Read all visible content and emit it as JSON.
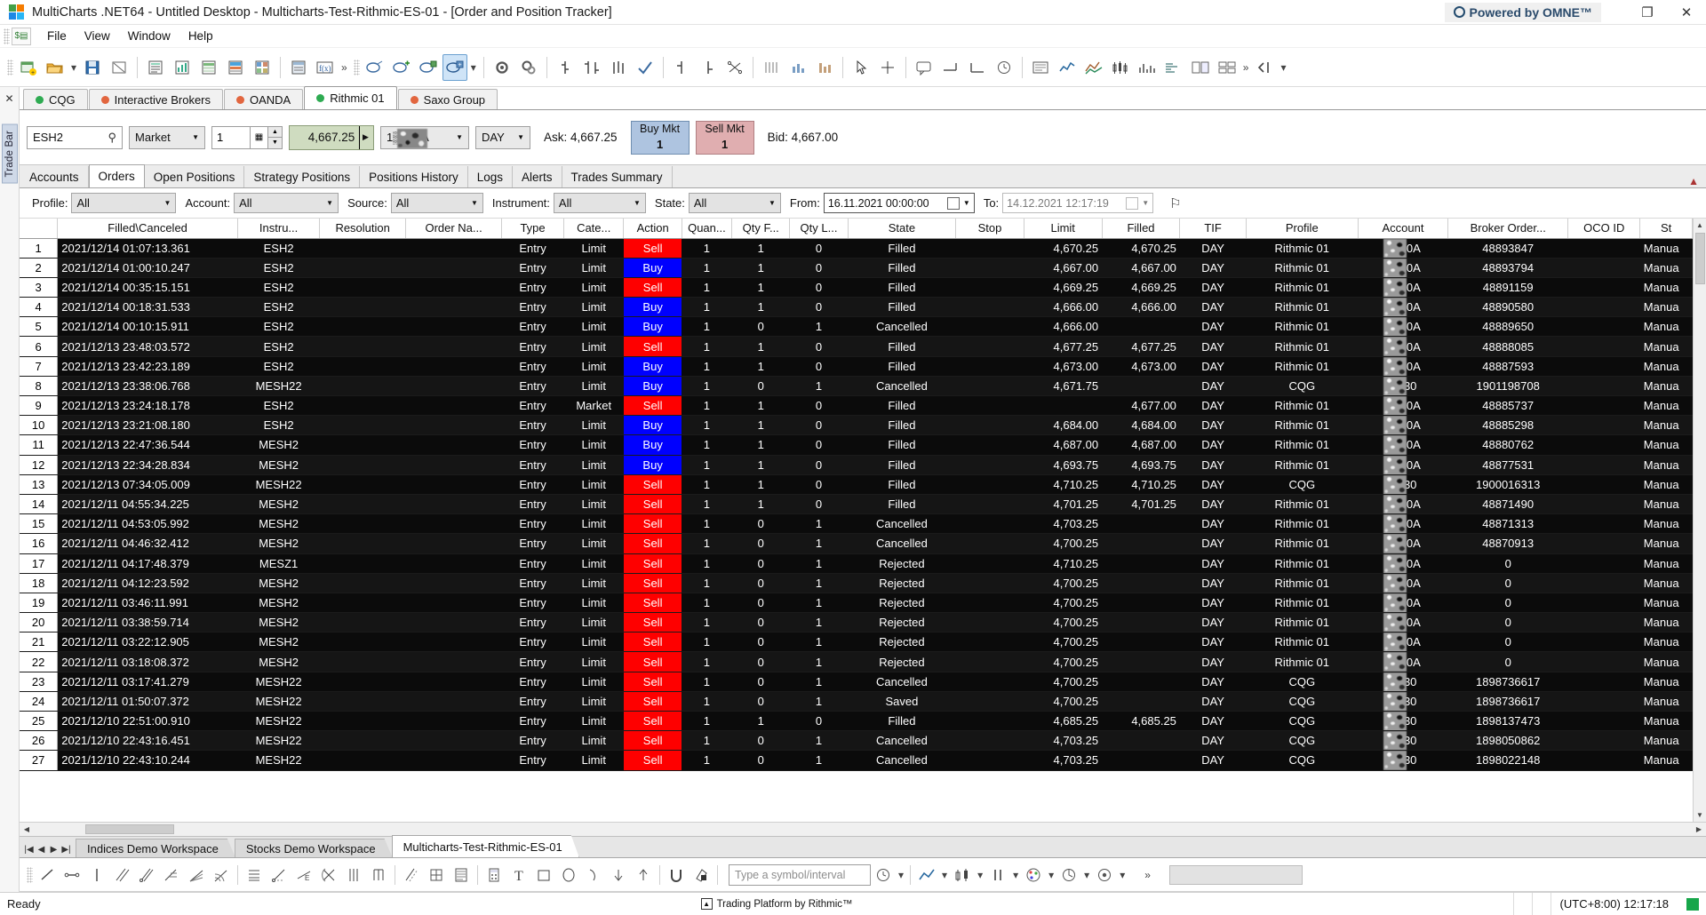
{
  "window": {
    "title": "MultiCharts .NET64 - Untitled Desktop - Multicharts-Test-Rithmic-ES-01 - [Order and Position Tracker]",
    "branding": "Powered by OMNE™",
    "restore_label": "❐",
    "close_label": "✕"
  },
  "menu": {
    "items": [
      "File",
      "View",
      "Window",
      "Help"
    ]
  },
  "rail": {
    "label": "Trade Bar",
    "close": "✕"
  },
  "connections": [
    {
      "name": "CQG",
      "status_color": "#2eab52"
    },
    {
      "name": "Interactive Brokers",
      "status_color": "#e2663f"
    },
    {
      "name": "OANDA",
      "status_color": "#e2663f"
    },
    {
      "name": "Rithmic 01",
      "status_color": "#2eab52",
      "selected": true
    },
    {
      "name": "Saxo Group",
      "status_color": "#e2663f"
    }
  ],
  "tradebar": {
    "symbol": "ESH2",
    "search_icon": "⚲",
    "order_type": "Market",
    "quantity": "1",
    "price": "4,667.25",
    "account": "1▒▒30A",
    "tif": "DAY",
    "ask_label": "Ask: 4,667.25",
    "bid_label": "Bid: 4,667.00",
    "buy_button": {
      "label": "Buy Mkt",
      "qty": "1"
    },
    "sell_button": {
      "label": "Sell Mkt",
      "qty": "1"
    }
  },
  "panel_tabs": [
    "Accounts",
    "Orders",
    "Open Positions",
    "Strategy Positions",
    "Positions History",
    "Logs",
    "Alerts",
    "Trades Summary"
  ],
  "panel_tab_selected": "Orders",
  "filters": {
    "profile": {
      "label": "Profile:",
      "value": "All"
    },
    "account": {
      "label": "Account:",
      "value": "All"
    },
    "source": {
      "label": "Source:",
      "value": "All"
    },
    "instrument": {
      "label": "Instrument:",
      "value": "All"
    },
    "state": {
      "label": "State:",
      "value": "All"
    },
    "from": {
      "label": "From:",
      "value": "16.11.2021 00:00:00"
    },
    "to": {
      "label": "To:",
      "value": "14.12.2021 12:17:19"
    },
    "pin_icon": "⚐"
  },
  "grid": {
    "columns": [
      "Filled\\Canceled",
      "Instru...",
      "Resolution",
      "Order Na...",
      "Type",
      "Cate...",
      "Action",
      "Quan...",
      "Qty F...",
      "Qty L...",
      "State",
      "Stop",
      "Limit",
      "Filled",
      "TIF",
      "Profile",
      "Account",
      "Broker Order...",
      "OCO ID",
      "St"
    ],
    "rows": [
      {
        "n": "1",
        "filled_canceled": "2021/12/14 01:07:13.361",
        "instrument": "ESH2",
        "resolution": "",
        "order_name": "",
        "type": "Entry",
        "category": "Limit",
        "action": "Sell",
        "qty": "1",
        "qty_filled": "1",
        "qty_left": "0",
        "state": "Filled",
        "stop": "",
        "limit": "4,670.25",
        "filled": "4,670.25",
        "tif": "DAY",
        "profile": "Rithmic 01",
        "account": "1▒30A",
        "broker_order_id": "48893847",
        "oco_id": "",
        "status": "Manua"
      },
      {
        "n": "2",
        "filled_canceled": "2021/12/14 01:00:10.247",
        "instrument": "ESH2",
        "resolution": "",
        "order_name": "",
        "type": "Entry",
        "category": "Limit",
        "action": "Buy",
        "qty": "1",
        "qty_filled": "1",
        "qty_left": "0",
        "state": "Filled",
        "stop": "",
        "limit": "4,667.00",
        "filled": "4,667.00",
        "tif": "DAY",
        "profile": "Rithmic 01",
        "account": "1▒30A",
        "broker_order_id": "48893794",
        "oco_id": "",
        "status": "Manua"
      },
      {
        "n": "3",
        "filled_canceled": "2021/12/14 00:35:15.151",
        "instrument": "ESH2",
        "resolution": "",
        "order_name": "",
        "type": "Entry",
        "category": "Limit",
        "action": "Sell",
        "qty": "1",
        "qty_filled": "1",
        "qty_left": "0",
        "state": "Filled",
        "stop": "",
        "limit": "4,669.25",
        "filled": "4,669.25",
        "tif": "DAY",
        "profile": "Rithmic 01",
        "account": "1▒30A",
        "broker_order_id": "48891159",
        "oco_id": "",
        "status": "Manua"
      },
      {
        "n": "4",
        "filled_canceled": "2021/12/14 00:18:31.533",
        "instrument": "ESH2",
        "resolution": "",
        "order_name": "",
        "type": "Entry",
        "category": "Limit",
        "action": "Buy",
        "qty": "1",
        "qty_filled": "1",
        "qty_left": "0",
        "state": "Filled",
        "stop": "",
        "limit": "4,666.00",
        "filled": "4,666.00",
        "tif": "DAY",
        "profile": "Rithmic 01",
        "account": "1▒30A",
        "broker_order_id": "48890580",
        "oco_id": "",
        "status": "Manua"
      },
      {
        "n": "5",
        "filled_canceled": "2021/12/14 00:10:15.911",
        "instrument": "ESH2",
        "resolution": "",
        "order_name": "",
        "type": "Entry",
        "category": "Limit",
        "action": "Buy",
        "qty": "1",
        "qty_filled": "0",
        "qty_left": "1",
        "state": "Cancelled",
        "stop": "",
        "limit": "4,666.00",
        "filled": "",
        "tif": "DAY",
        "profile": "Rithmic 01",
        "account": "1▒30A",
        "broker_order_id": "48889650",
        "oco_id": "",
        "status": "Manua"
      },
      {
        "n": "6",
        "filled_canceled": "2021/12/13 23:48:03.572",
        "instrument": "ESH2",
        "resolution": "",
        "order_name": "",
        "type": "Entry",
        "category": "Limit",
        "action": "Sell",
        "qty": "1",
        "qty_filled": "1",
        "qty_left": "0",
        "state": "Filled",
        "stop": "",
        "limit": "4,677.25",
        "filled": "4,677.25",
        "tif": "DAY",
        "profile": "Rithmic 01",
        "account": "1▒30A",
        "broker_order_id": "48888085",
        "oco_id": "",
        "status": "Manua"
      },
      {
        "n": "7",
        "filled_canceled": "2021/12/13 23:42:23.189",
        "instrument": "ESH2",
        "resolution": "",
        "order_name": "",
        "type": "Entry",
        "category": "Limit",
        "action": "Buy",
        "qty": "1",
        "qty_filled": "1",
        "qty_left": "0",
        "state": "Filled",
        "stop": "",
        "limit": "4,673.00",
        "filled": "4,673.00",
        "tif": "DAY",
        "profile": "Rithmic 01",
        "account": "1▒30A",
        "broker_order_id": "48887593",
        "oco_id": "",
        "status": "Manua"
      },
      {
        "n": "8",
        "filled_canceled": "2021/12/13 23:38:06.768",
        "instrument": "MESH22",
        "resolution": "",
        "order_name": "",
        "type": "Entry",
        "category": "Limit",
        "action": "Buy",
        "qty": "1",
        "qty_filled": "0",
        "qty_left": "1",
        "state": "Cancelled",
        "stop": "",
        "limit": "4,671.75",
        "filled": "",
        "tif": "DAY",
        "profile": "CQG",
        "account": "1▒30",
        "broker_order_id": "1901198708",
        "oco_id": "",
        "status": "Manua"
      },
      {
        "n": "9",
        "filled_canceled": "2021/12/13 23:24:18.178",
        "instrument": "ESH2",
        "resolution": "",
        "order_name": "",
        "type": "Entry",
        "category": "Market",
        "action": "Sell",
        "qty": "1",
        "qty_filled": "1",
        "qty_left": "0",
        "state": "Filled",
        "stop": "",
        "limit": "",
        "filled": "4,677.00",
        "tif": "DAY",
        "profile": "Rithmic 01",
        "account": "1▒30A",
        "broker_order_id": "48885737",
        "oco_id": "",
        "status": "Manua"
      },
      {
        "n": "10",
        "filled_canceled": "2021/12/13 23:21:08.180",
        "instrument": "ESH2",
        "resolution": "",
        "order_name": "",
        "type": "Entry",
        "category": "Limit",
        "action": "Buy",
        "qty": "1",
        "qty_filled": "1",
        "qty_left": "0",
        "state": "Filled",
        "stop": "",
        "limit": "4,684.00",
        "filled": "4,684.00",
        "tif": "DAY",
        "profile": "Rithmic 01",
        "account": "1▒30A",
        "broker_order_id": "48885298",
        "oco_id": "",
        "status": "Manua"
      },
      {
        "n": "11",
        "filled_canceled": "2021/12/13 22:47:36.544",
        "instrument": "MESH2",
        "resolution": "",
        "order_name": "",
        "type": "Entry",
        "category": "Limit",
        "action": "Buy",
        "qty": "1",
        "qty_filled": "1",
        "qty_left": "0",
        "state": "Filled",
        "stop": "",
        "limit": "4,687.00",
        "filled": "4,687.00",
        "tif": "DAY",
        "profile": "Rithmic 01",
        "account": "1▒30A",
        "broker_order_id": "48880762",
        "oco_id": "",
        "status": "Manua"
      },
      {
        "n": "12",
        "filled_canceled": "2021/12/13 22:34:28.834",
        "instrument": "MESH2",
        "resolution": "",
        "order_name": "",
        "type": "Entry",
        "category": "Limit",
        "action": "Buy",
        "qty": "1",
        "qty_filled": "1",
        "qty_left": "0",
        "state": "Filled",
        "stop": "",
        "limit": "4,693.75",
        "filled": "4,693.75",
        "tif": "DAY",
        "profile": "Rithmic 01",
        "account": "1▒30A",
        "broker_order_id": "48877531",
        "oco_id": "",
        "status": "Manua"
      },
      {
        "n": "13",
        "filled_canceled": "2021/12/13 07:34:05.009",
        "instrument": "MESH22",
        "resolution": "",
        "order_name": "",
        "type": "Entry",
        "category": "Limit",
        "action": "Sell",
        "qty": "1",
        "qty_filled": "1",
        "qty_left": "0",
        "state": "Filled",
        "stop": "",
        "limit": "4,710.25",
        "filled": "4,710.25",
        "tif": "DAY",
        "profile": "CQG",
        "account": "1▒30",
        "broker_order_id": "1900016313",
        "oco_id": "",
        "status": "Manua"
      },
      {
        "n": "14",
        "filled_canceled": "2021/12/11 04:55:34.225",
        "instrument": "MESH2",
        "resolution": "",
        "order_name": "",
        "type": "Entry",
        "category": "Limit",
        "action": "Sell",
        "qty": "1",
        "qty_filled": "1",
        "qty_left": "0",
        "state": "Filled",
        "stop": "",
        "limit": "4,701.25",
        "filled": "4,701.25",
        "tif": "DAY",
        "profile": "Rithmic 01",
        "account": "1▒30A",
        "broker_order_id": "48871490",
        "oco_id": "",
        "status": "Manua"
      },
      {
        "n": "15",
        "filled_canceled": "2021/12/11 04:53:05.992",
        "instrument": "MESH2",
        "resolution": "",
        "order_name": "",
        "type": "Entry",
        "category": "Limit",
        "action": "Sell",
        "qty": "1",
        "qty_filled": "0",
        "qty_left": "1",
        "state": "Cancelled",
        "stop": "",
        "limit": "4,703.25",
        "filled": "",
        "tif": "DAY",
        "profile": "Rithmic 01",
        "account": "1▒30A",
        "broker_order_id": "48871313",
        "oco_id": "",
        "status": "Manua"
      },
      {
        "n": "16",
        "filled_canceled": "2021/12/11 04:46:32.412",
        "instrument": "MESH2",
        "resolution": "",
        "order_name": "",
        "type": "Entry",
        "category": "Limit",
        "action": "Sell",
        "qty": "1",
        "qty_filled": "0",
        "qty_left": "1",
        "state": "Cancelled",
        "stop": "",
        "limit": "4,700.25",
        "filled": "",
        "tif": "DAY",
        "profile": "Rithmic 01",
        "account": "1▒30A",
        "broker_order_id": "48870913",
        "oco_id": "",
        "status": "Manua"
      },
      {
        "n": "17",
        "filled_canceled": "2021/12/11 04:17:48.379",
        "instrument": "MESZ1",
        "resolution": "",
        "order_name": "",
        "type": "Entry",
        "category": "Limit",
        "action": "Sell",
        "qty": "1",
        "qty_filled": "0",
        "qty_left": "1",
        "state": "Rejected",
        "stop": "",
        "limit": "4,710.25",
        "filled": "",
        "tif": "DAY",
        "profile": "Rithmic 01",
        "account": "1▒30A",
        "broker_order_id": "0",
        "oco_id": "",
        "status": "Manua"
      },
      {
        "n": "18",
        "filled_canceled": "2021/12/11 04:12:23.592",
        "instrument": "MESH2",
        "resolution": "",
        "order_name": "",
        "type": "Entry",
        "category": "Limit",
        "action": "Sell",
        "qty": "1",
        "qty_filled": "0",
        "qty_left": "1",
        "state": "Rejected",
        "stop": "",
        "limit": "4,700.25",
        "filled": "",
        "tif": "DAY",
        "profile": "Rithmic 01",
        "account": "1▒30A",
        "broker_order_id": "0",
        "oco_id": "",
        "status": "Manua"
      },
      {
        "n": "19",
        "filled_canceled": "2021/12/11 03:46:11.991",
        "instrument": "MESH2",
        "resolution": "",
        "order_name": "",
        "type": "Entry",
        "category": "Limit",
        "action": "Sell",
        "qty": "1",
        "qty_filled": "0",
        "qty_left": "1",
        "state": "Rejected",
        "stop": "",
        "limit": "4,700.25",
        "filled": "",
        "tif": "DAY",
        "profile": "Rithmic 01",
        "account": "1▒30A",
        "broker_order_id": "0",
        "oco_id": "",
        "status": "Manua"
      },
      {
        "n": "20",
        "filled_canceled": "2021/12/11 03:38:59.714",
        "instrument": "MESH2",
        "resolution": "",
        "order_name": "",
        "type": "Entry",
        "category": "Limit",
        "action": "Sell",
        "qty": "1",
        "qty_filled": "0",
        "qty_left": "1",
        "state": "Rejected",
        "stop": "",
        "limit": "4,700.25",
        "filled": "",
        "tif": "DAY",
        "profile": "Rithmic 01",
        "account": "1▒30A",
        "broker_order_id": "0",
        "oco_id": "",
        "status": "Manua"
      },
      {
        "n": "21",
        "filled_canceled": "2021/12/11 03:22:12.905",
        "instrument": "MESH2",
        "resolution": "",
        "order_name": "",
        "type": "Entry",
        "category": "Limit",
        "action": "Sell",
        "qty": "1",
        "qty_filled": "0",
        "qty_left": "1",
        "state": "Rejected",
        "stop": "",
        "limit": "4,700.25",
        "filled": "",
        "tif": "DAY",
        "profile": "Rithmic 01",
        "account": "1▒30A",
        "broker_order_id": "0",
        "oco_id": "",
        "status": "Manua"
      },
      {
        "n": "22",
        "filled_canceled": "2021/12/11 03:18:08.372",
        "instrument": "MESH2",
        "resolution": "",
        "order_name": "",
        "type": "Entry",
        "category": "Limit",
        "action": "Sell",
        "qty": "1",
        "qty_filled": "0",
        "qty_left": "1",
        "state": "Rejected",
        "stop": "",
        "limit": "4,700.25",
        "filled": "",
        "tif": "DAY",
        "profile": "Rithmic 01",
        "account": "1▒30A",
        "broker_order_id": "0",
        "oco_id": "",
        "status": "Manua"
      },
      {
        "n": "23",
        "filled_canceled": "2021/12/11 03:17:41.279",
        "instrument": "MESH22",
        "resolution": "",
        "order_name": "",
        "type": "Entry",
        "category": "Limit",
        "action": "Sell",
        "qty": "1",
        "qty_filled": "0",
        "qty_left": "1",
        "state": "Cancelled",
        "stop": "",
        "limit": "4,700.25",
        "filled": "",
        "tif": "DAY",
        "profile": "CQG",
        "account": "1▒30",
        "broker_order_id": "1898736617",
        "oco_id": "",
        "status": "Manua"
      },
      {
        "n": "24",
        "filled_canceled": "2021/12/11 01:50:07.372",
        "instrument": "MESH22",
        "resolution": "",
        "order_name": "",
        "type": "Entry",
        "category": "Limit",
        "action": "Sell",
        "qty": "1",
        "qty_filled": "0",
        "qty_left": "1",
        "state": "Saved",
        "stop": "",
        "limit": "4,700.25",
        "filled": "",
        "tif": "DAY",
        "profile": "CQG",
        "account": "1▒30",
        "broker_order_id": "1898736617",
        "oco_id": "",
        "status": "Manua"
      },
      {
        "n": "25",
        "filled_canceled": "2021/12/10 22:51:00.910",
        "instrument": "MESH22",
        "resolution": "",
        "order_name": "",
        "type": "Entry",
        "category": "Limit",
        "action": "Sell",
        "qty": "1",
        "qty_filled": "1",
        "qty_left": "0",
        "state": "Filled",
        "stop": "",
        "limit": "4,685.25",
        "filled": "4,685.25",
        "tif": "DAY",
        "profile": "CQG",
        "account": "1▒30",
        "broker_order_id": "1898137473",
        "oco_id": "",
        "status": "Manua"
      },
      {
        "n": "26",
        "filled_canceled": "2021/12/10 22:43:16.451",
        "instrument": "MESH22",
        "resolution": "",
        "order_name": "",
        "type": "Entry",
        "category": "Limit",
        "action": "Sell",
        "qty": "1",
        "qty_filled": "0",
        "qty_left": "1",
        "state": "Cancelled",
        "stop": "",
        "limit": "4,703.25",
        "filled": "",
        "tif": "DAY",
        "profile": "CQG",
        "account": "1▒30",
        "broker_order_id": "1898050862",
        "oco_id": "",
        "status": "Manua"
      },
      {
        "n": "27",
        "filled_canceled": "2021/12/10 22:43:10.244",
        "instrument": "MESH22",
        "resolution": "",
        "order_name": "",
        "type": "Entry",
        "category": "Limit",
        "action": "Sell",
        "qty": "1",
        "qty_filled": "0",
        "qty_left": "1",
        "state": "Cancelled",
        "stop": "",
        "limit": "4,703.25",
        "filled": "",
        "tif": "DAY",
        "profile": "CQG",
        "account": "1▒30",
        "broker_order_id": "1898022148",
        "oco_id": "",
        "status": "Manua"
      }
    ]
  },
  "workspaces": {
    "tabs": [
      "Indices Demo Workspace",
      "Stocks Demo Workspace",
      "Multicharts-Test-Rithmic-ES-01"
    ],
    "selected": "Multicharts-Test-Rithmic-ES-01"
  },
  "drawbar": {
    "symbol_placeholder": "Type a symbol/interval"
  },
  "statusbar": {
    "ready": "Ready",
    "platform": "Trading Platform by Rithmic™",
    "clock": "(UTC+8:00) 12:17:18",
    "led_color": "#17a64a"
  }
}
